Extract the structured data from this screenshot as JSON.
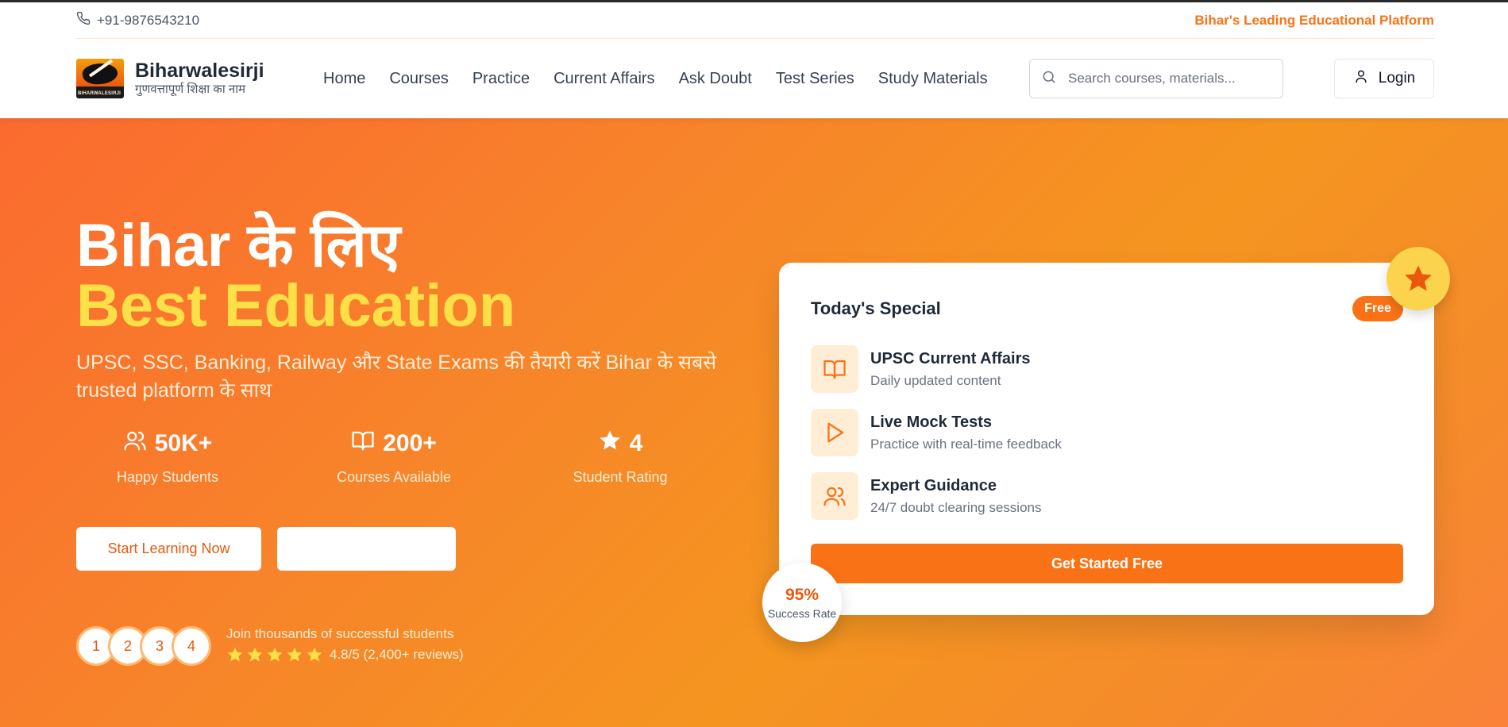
{
  "topbar": {
    "phone": "+91-9876543210",
    "tagline": "Bihar's Leading Educational Platform"
  },
  "brand": {
    "name": "Biharwalesirji",
    "subtitle": "गुणवत्तापूर्ण शिक्षा का नाम",
    "logo_text": "BIHARWALESIRJI"
  },
  "nav": {
    "items": [
      {
        "label": "Home"
      },
      {
        "label": "Courses"
      },
      {
        "label": "Practice"
      },
      {
        "label": "Current Affairs"
      },
      {
        "label": "Ask Doubt"
      },
      {
        "label": "Test Series"
      },
      {
        "label": "Study Materials"
      }
    ]
  },
  "search": {
    "placeholder": "Search courses, materials...",
    "value": ""
  },
  "login": {
    "label": "Login"
  },
  "hero": {
    "title_line1": "Bihar के लिए",
    "title_line2": "Best Education",
    "description": "UPSC, SSC, Banking, Railway और State Exams की तैयारी करें Bihar के सबसे trusted platform के साथ",
    "stats": [
      {
        "icon": "users-icon",
        "value": "50K+",
        "label": "Happy Students"
      },
      {
        "icon": "book-icon",
        "value": "200+",
        "label": "Courses Available"
      },
      {
        "icon": "star-icon",
        "value": "4",
        "label": "Student Rating"
      }
    ],
    "primary_button": "Start Learning Now",
    "secondary_button": "",
    "avatars": [
      "1",
      "2",
      "3",
      "4"
    ],
    "join_text": "Join thousands of successful students",
    "rating_stars": 5,
    "rating_text": "4.8/5 (2,400+ reviews)"
  },
  "card": {
    "title": "Today's Special",
    "badge": "Free",
    "features": [
      {
        "icon": "book-open-icon",
        "title": "UPSC Current Affairs",
        "subtitle": "Daily updated content"
      },
      {
        "icon": "play-icon",
        "title": "Live Mock Tests",
        "subtitle": "Practice with real-time feedback"
      },
      {
        "icon": "users-icon",
        "title": "Expert Guidance",
        "subtitle": "24/7 doubt clearing sessions"
      }
    ],
    "cta": "Get Started Free",
    "success_value": "95%",
    "success_label": "Success Rate"
  },
  "colors": {
    "accent": "#f97316",
    "highlight": "#fde047",
    "star_bubble": "#fcd34d"
  }
}
